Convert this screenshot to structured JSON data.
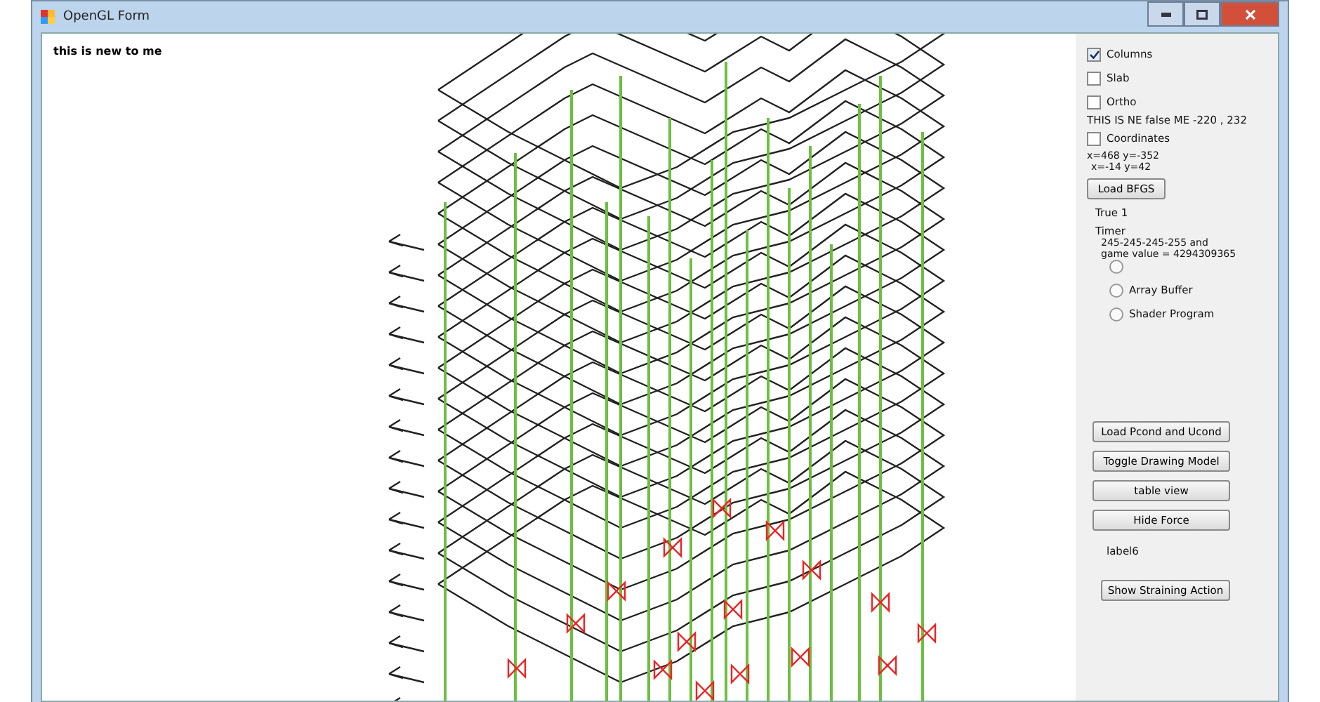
{
  "window": {
    "title": "OpenGL Form"
  },
  "canvas": {
    "caption": "this is new to me"
  },
  "panel": {
    "checkboxes": [
      {
        "label": "Columns",
        "checked": true
      },
      {
        "label": "Slab",
        "checked": false
      },
      {
        "label": "Ortho",
        "checked": false
      }
    ],
    "status_line": "THIS IS NE false  ME  -220 , 232",
    "coordinates": {
      "label": "Coordinates",
      "checked": false
    },
    "mouse_lines": [
      "x=468 y=-352",
      "x=-14 y=42"
    ],
    "load_button": "Load BFGS",
    "true_label": "True 1",
    "timer_label": "Timer",
    "color_lines": [
      "245-245-245-255 and",
      "game value = 4294309365"
    ],
    "radios": [
      {
        "selected": false
      },
      {
        "label": "Array Buffer",
        "selected": false
      },
      {
        "label": "Shader Program",
        "selected": false
      }
    ],
    "buttons": [
      "Load Pcond and Ucond",
      "Toggle Drawing Model",
      "table view",
      "Hide Force"
    ],
    "label6": "label6",
    "bottom_button": "Show Straining Action"
  }
}
